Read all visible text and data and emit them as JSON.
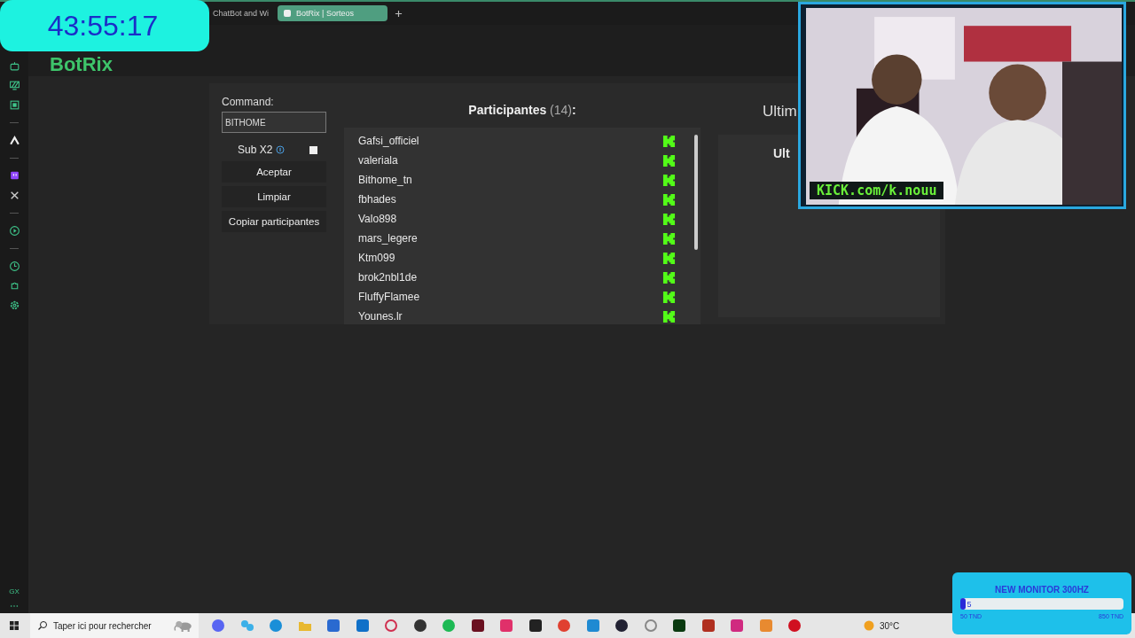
{
  "timer": "43:55:17",
  "browser_tabs": [
    {
      "label": "ChatBot and Wi",
      "selected": false
    },
    {
      "label": "BotRix | Sorteos",
      "selected": true
    }
  ],
  "brand": "BotRix",
  "sidebar": {
    "bottom_label": "GX"
  },
  "command": {
    "label": "Command:",
    "value": "BITHOME"
  },
  "sub_x2": {
    "label": "Sub X2",
    "checked": false
  },
  "buttons": [
    "Aceptar",
    "Limpiar",
    "Copiar participantes"
  ],
  "participants": {
    "title": "**Participantes** (14)**:**",
    "names": [
      "Gafsi_officiel",
      "valeriala",
      "Bithome_tn",
      "fbhades",
      "Valo898",
      "mars_legere",
      "Ktm099",
      "brok2nbl1de",
      "FluffyFlamee",
      "Younes.lr"
    ]
  },
  "last_panel": {
    "title": "Ultim",
    "inner_title": "Ult"
  },
  "webcam": {
    "kind": "picture",
    "banner": "KICK.com/k.nouu"
  },
  "goal": {
    "title": "NEW MONITOR 300HZ",
    "level": 0.03,
    "current": "5",
    "min": "50 TND",
    "max": "850 TND"
  },
  "taskbar": {
    "search_placeholder": "Taper ici pour rechercher",
    "temperature": "30°C"
  }
}
